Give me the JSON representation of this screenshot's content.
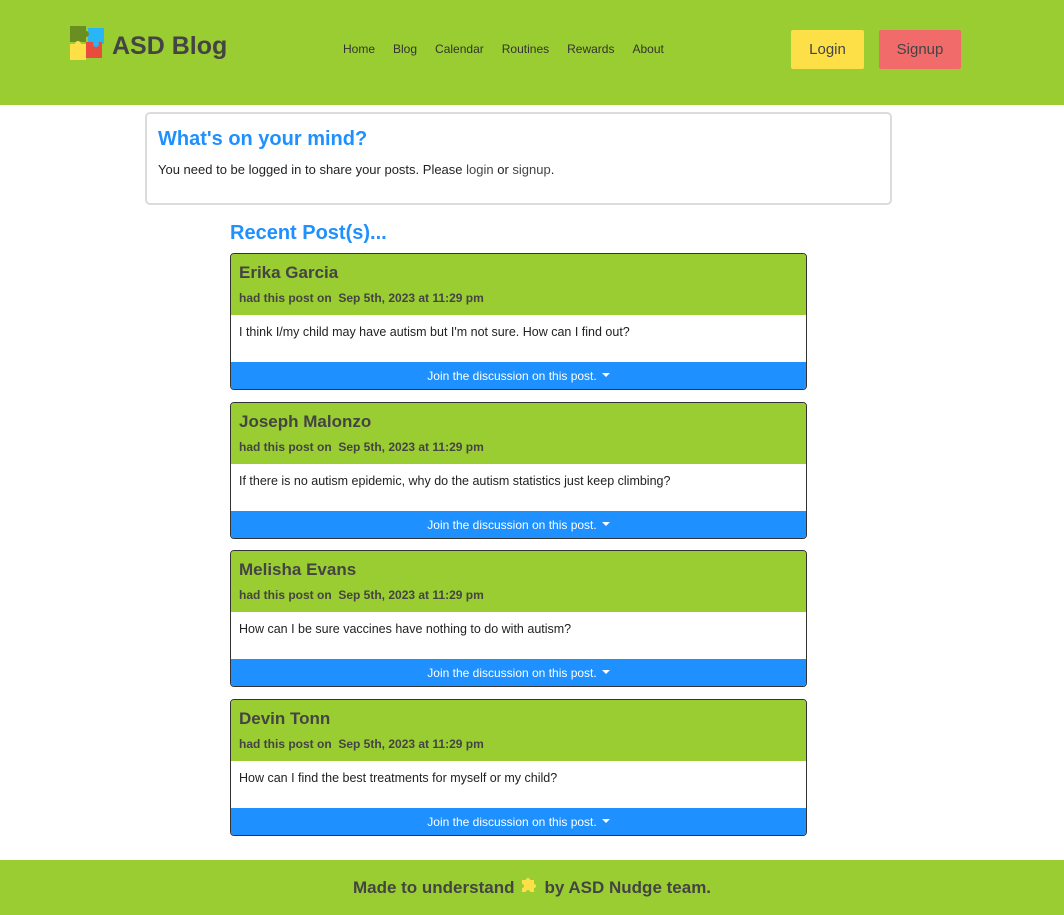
{
  "header": {
    "logo_text": "ASD Blog",
    "nav": [
      "Home",
      "Blog",
      "Calendar",
      "Routines",
      "Rewards",
      "About"
    ],
    "login_label": "Login",
    "signup_label": "Signup"
  },
  "mind": {
    "title": "What's on your mind?",
    "text_before": "You need to be logged in to share your posts. Please ",
    "login_link": "login",
    "text_middle": " or ",
    "signup_link": "signup",
    "text_after": "."
  },
  "recent_title": "Recent Post(s)...",
  "posts": [
    {
      "author": "Erika Garcia",
      "meta_prefix": "had this post on",
      "date": "Sep 5th, 2023 at 11:29 pm",
      "text": "I think I/my child may have autism but I'm not sure. How can I find out?",
      "discussion_label": "Join the discussion on this post."
    },
    {
      "author": "Joseph Malonzo",
      "meta_prefix": "had this post on",
      "date": "Sep 5th, 2023 at 11:29 pm",
      "text": "If there is no autism epidemic, why do the autism statistics just keep climbing?",
      "discussion_label": "Join the discussion on this post."
    },
    {
      "author": "Melisha Evans",
      "meta_prefix": "had this post on",
      "date": "Sep 5th, 2023 at 11:29 pm",
      "text": "How can I be sure vaccines have nothing to do with autism?",
      "discussion_label": "Join the discussion on this post."
    },
    {
      "author": "Devin Tonn",
      "meta_prefix": "had this post on",
      "date": "Sep 5th, 2023 at 11:29 pm",
      "text": "How can I find the best treatments for myself or my child?",
      "discussion_label": "Join the discussion on this post."
    }
  ],
  "footer": {
    "text_before": "Made to understand",
    "icon": "puzzle-piece-icon",
    "text_after": "by ASD Nudge team."
  },
  "colors": {
    "brand_green": "#9acd32",
    "accent_blue": "#1e90ff",
    "login_yellow": "#fde047",
    "signup_red": "#f26b6b"
  }
}
